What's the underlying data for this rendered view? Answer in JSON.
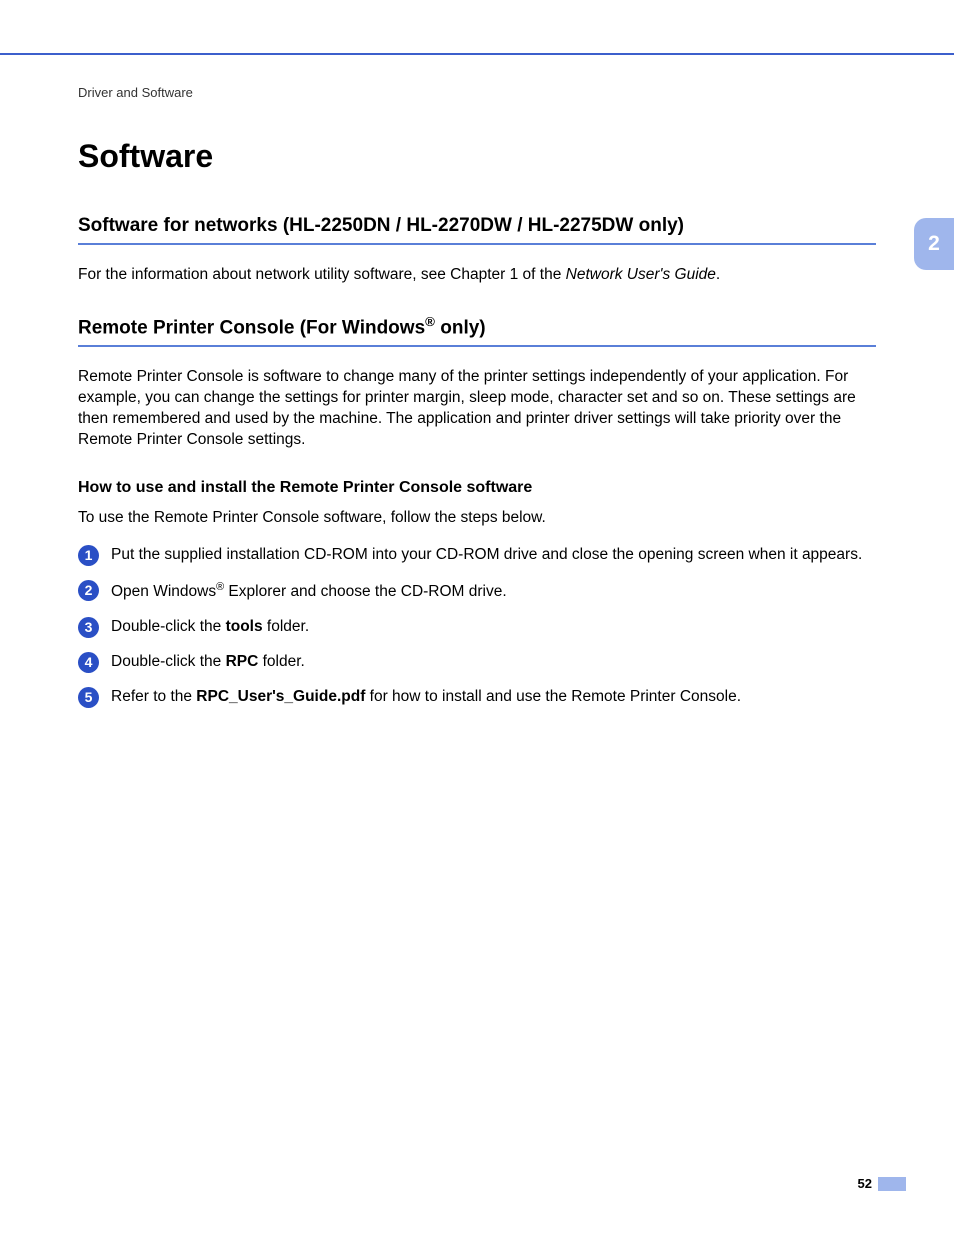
{
  "breadcrumb": "Driver and Software",
  "page_title": "Software",
  "side_tab": "2",
  "page_number": "52",
  "section1": {
    "heading": "Software for networks (HL-2250DN / HL-2270DW / HL-2275DW only)",
    "para_pre": "For the information about network utility software, see Chapter 1 of the ",
    "para_italic": "Network User's Guide",
    "para_post": "."
  },
  "section2": {
    "heading_pre": "Remote Printer Console  (For Windows",
    "heading_sup": "®",
    "heading_post": " only)",
    "para": "Remote Printer Console is software to change many of the printer settings independently of your application. For example, you can change the settings for printer margin, sleep mode, character set and so on. These settings are then remembered and used by the machine. The application and printer driver settings will take priority over the Remote Printer Console settings.",
    "sub_heading": "How to use and install the Remote Printer Console software",
    "intro_line": "To use the Remote Printer Console software, follow the steps below.",
    "steps": [
      {
        "num": "1",
        "text": "Put the supplied installation CD-ROM into your CD-ROM drive and close the opening screen when it appears."
      },
      {
        "num": "2",
        "pre": "Open Windows",
        "sup": "®",
        "post": " Explorer and choose the CD-ROM drive."
      },
      {
        "num": "3",
        "pre": "Double-click the ",
        "bold": "tools",
        "post": " folder."
      },
      {
        "num": "4",
        "pre": "Double-click the ",
        "bold": "RPC",
        "post": " folder."
      },
      {
        "num": "5",
        "pre": "Refer to the ",
        "bold": "RPC_User's_Guide.pdf",
        "post": " for how to install and use the Remote Printer Console."
      }
    ]
  }
}
